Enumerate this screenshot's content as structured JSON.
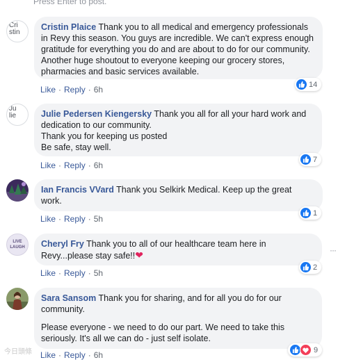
{
  "composer_hint": "Press Enter to post.",
  "actions": {
    "like": "Like",
    "reply": "Reply",
    "separator": "·"
  },
  "comments": [
    {
      "name": "Cristin Plaice",
      "avatar_alt": "Cri\nstin",
      "paragraphs": [
        "Thank you to all medical and emergency professionals in Revy this season. You guys are incredible. We can't express enough gratitude for everything you do and are about to do for our community. Another huge shoutout to everyone keeping our grocery stores, pharmacies and basic services available."
      ],
      "time": "6h",
      "reaction_count": "14"
    },
    {
      "name": "Julie Pedersen Kiengersky",
      "avatar_alt": "Ju\nlie",
      "paragraphs": [
        "Thank you all for all your hard work and dedication to our community.",
        "Thank you for keeping us posted",
        "Be safe, stay well."
      ],
      "time": "6h",
      "reaction_count": "7"
    },
    {
      "name": "Ian Francis VVard",
      "paragraphs": [
        "Thank you Selkirk Medical. Keep up the great work."
      ],
      "time": "5h",
      "reaction_count": "1"
    },
    {
      "name": "Cheryl Fry",
      "avatar_text": "LIVE\nLAUGH",
      "paragraphs": [
        "Thank you to all of our healthcare team here in Revy...please stay safe!!"
      ],
      "emoji": "heart",
      "time": "5h",
      "reaction_count": "2"
    },
    {
      "name": "Sara Sansom",
      "paragraphs": [
        "Thank you for sharing, and for all you do for our community.",
        "Please everyone - we need to do our part. We need to take this seriously. It's all we can do - just self isolate."
      ],
      "time": "6h",
      "reaction_count": "9"
    }
  ],
  "more_options": "···",
  "watermark": "今日頭條"
}
